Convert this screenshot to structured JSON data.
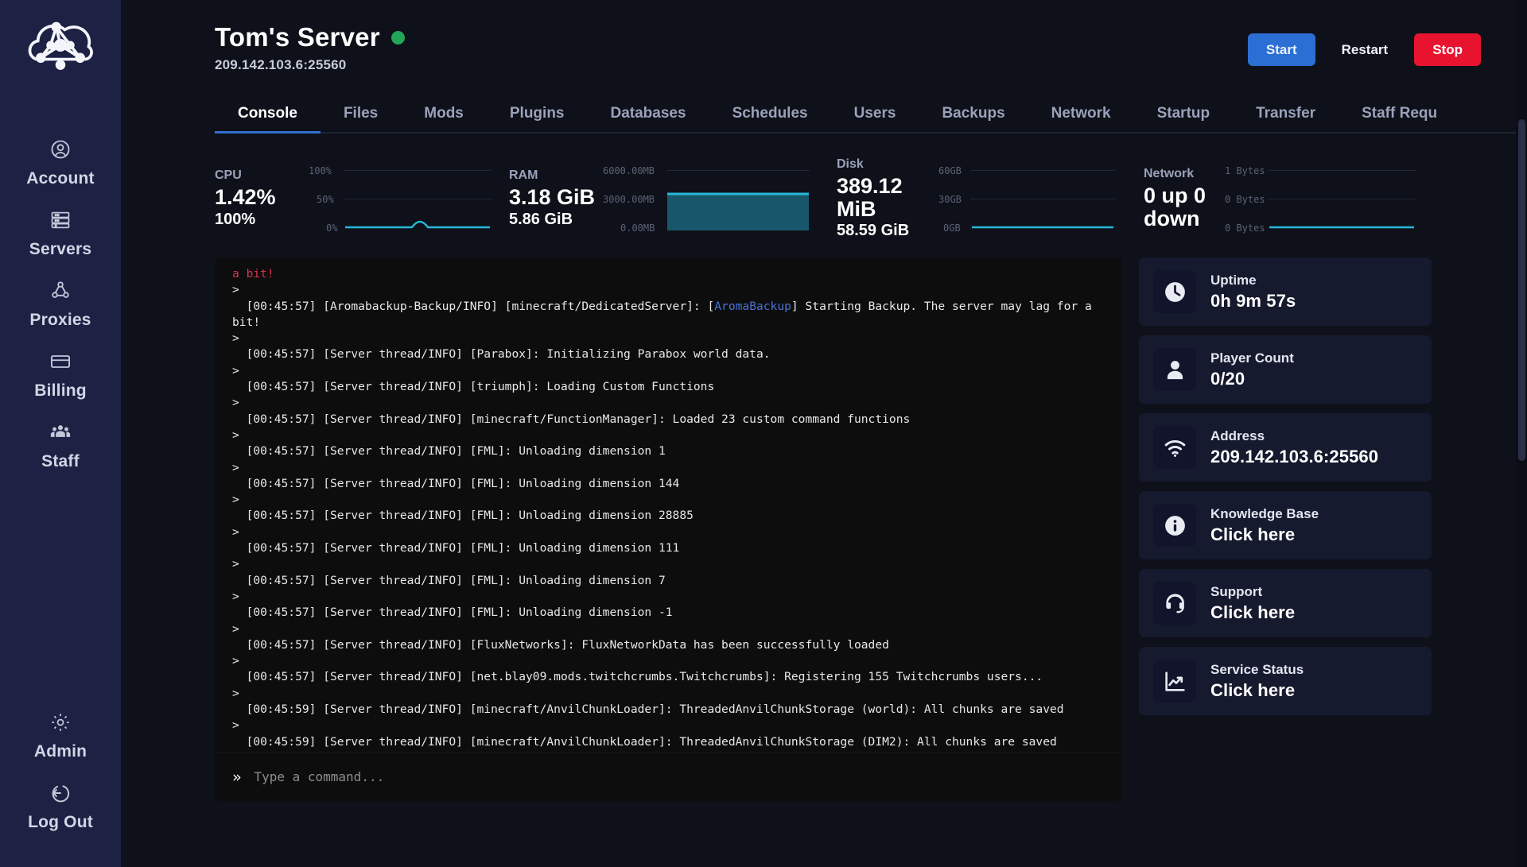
{
  "sidebar": {
    "logo_name": "cloud-network-logo",
    "items": [
      {
        "id": "account",
        "label": "Account",
        "icon": "user-circle-icon"
      },
      {
        "id": "servers",
        "label": "Servers",
        "icon": "server-rack-icon"
      },
      {
        "id": "proxies",
        "label": "Proxies",
        "icon": "proxy-nodes-icon"
      },
      {
        "id": "billing",
        "label": "Billing",
        "icon": "credit-card-icon"
      },
      {
        "id": "staff",
        "label": "Staff",
        "icon": "people-group-icon"
      }
    ],
    "bottom_items": [
      {
        "id": "admin",
        "label": "Admin",
        "icon": "gear-icon"
      },
      {
        "id": "logout",
        "label": "Log Out",
        "icon": "logout-icon"
      }
    ]
  },
  "header": {
    "title": "Tom's Server",
    "status": "online",
    "status_color": "#23a55a",
    "address": "209.142.103.6:25560",
    "buttons": {
      "start": "Start",
      "restart": "Restart",
      "stop": "Stop"
    },
    "colors": {
      "start": "#2b6fd4",
      "stop": "#e8132e",
      "accent": "#2f6fd0"
    }
  },
  "tabs": {
    "active": "Console",
    "items": [
      "Console",
      "Files",
      "Mods",
      "Plugins",
      "Databases",
      "Schedules",
      "Users",
      "Backups",
      "Network",
      "Startup",
      "Transfer",
      "Staff Requ"
    ]
  },
  "stats": [
    {
      "id": "cpu",
      "label": "CPU",
      "value": "1.42%",
      "sub": "100%",
      "axis": [
        "100%",
        "50%",
        "0%"
      ]
    },
    {
      "id": "ram",
      "label": "RAM",
      "value": "3.18 GiB",
      "sub": "5.86 GiB",
      "axis": [
        "6000.00MB",
        "3000.00MB",
        "0.00MB"
      ]
    },
    {
      "id": "disk",
      "label": "Disk",
      "value": "389.12 MiB",
      "sub": "58.59 GiB",
      "axis": [
        "60GB",
        "30GB",
        "0GB"
      ]
    },
    {
      "id": "network",
      "label": "Network",
      "value": "0 up 0 down",
      "sub": "",
      "axis": [
        "1 Bytes",
        "0 Bytes",
        "0 Bytes"
      ]
    }
  ],
  "chart_data": [
    {
      "type": "line",
      "id": "cpu-chart",
      "title": "CPU",
      "ylabel": "",
      "ytick_labels": [
        "100%",
        "50%",
        "0%"
      ],
      "ylim": [
        0,
        100
      ],
      "values": [
        0.8,
        0.9,
        0.8,
        1.0,
        0.9,
        0.8,
        1.0,
        1.1,
        0.9,
        1.0,
        0.9,
        1.0,
        1.2,
        6.0,
        1.3,
        1.0,
        0.9,
        1.0,
        1.1,
        1.42
      ],
      "line_color": "#27b7d8",
      "grid": true,
      "legend": "none"
    },
    {
      "type": "area",
      "id": "ram-chart",
      "title": "RAM",
      "ytick_labels": [
        "6000.00MB",
        "3000.00MB",
        "0.00MB"
      ],
      "ylim": [
        0,
        6000
      ],
      "values": [
        3250,
        3250,
        3250,
        3250,
        3250,
        3250,
        3250,
        3250,
        3250,
        3250
      ],
      "line_color": "#27b7d8",
      "fill_color": "#18576b",
      "grid": true,
      "legend": "none"
    },
    {
      "type": "line",
      "id": "disk-chart",
      "title": "Disk",
      "ytick_labels": [
        "60GB",
        "30GB",
        "0GB"
      ],
      "ylim": [
        0,
        60
      ],
      "values": [
        0.38,
        0.38,
        0.38,
        0.38,
        0.38,
        0.38,
        0.38,
        0.38,
        0.38,
        0.38
      ],
      "line_color": "#27b7d8",
      "grid": true,
      "legend": "none"
    },
    {
      "type": "line",
      "id": "network-chart",
      "title": "Network",
      "ytick_labels": [
        "1 Bytes",
        "0 Bytes",
        "0 Bytes"
      ],
      "ylim": [
        0,
        1
      ],
      "values": [
        0,
        0,
        0,
        0,
        0,
        0,
        0,
        0,
        0,
        0
      ],
      "line_color": "#27b7d8",
      "grid": true,
      "legend": "none"
    }
  ],
  "console": {
    "lines": [
      {
        "type": "text",
        "color": "red",
        "text": "a bit!"
      },
      {
        "type": "prompt",
        "text": ">"
      },
      {
        "type": "text",
        "text": "  [00:45:57] [Aromabackup-Backup/INFO] [minecraft/DedicatedServer]: [",
        "highlight": "AromaBackup",
        "after": "] Starting Backup. The server may lag for a bit!"
      },
      {
        "type": "prompt",
        "text": ">"
      },
      {
        "type": "text",
        "text": "  [00:45:57] [Server thread/INFO] [Parabox]: Initializing Parabox world data."
      },
      {
        "type": "prompt",
        "text": ">"
      },
      {
        "type": "text",
        "text": "  [00:45:57] [Server thread/INFO] [triumph]: Loading Custom Functions"
      },
      {
        "type": "prompt",
        "text": ">"
      },
      {
        "type": "text",
        "text": "  [00:45:57] [Server thread/INFO] [minecraft/FunctionManager]: Loaded 23 custom command functions"
      },
      {
        "type": "prompt",
        "text": ">"
      },
      {
        "type": "text",
        "text": "  [00:45:57] [Server thread/INFO] [FML]: Unloading dimension 1"
      },
      {
        "type": "prompt",
        "text": ">"
      },
      {
        "type": "text",
        "text": "  [00:45:57] [Server thread/INFO] [FML]: Unloading dimension 144"
      },
      {
        "type": "prompt",
        "text": ">"
      },
      {
        "type": "text",
        "text": "  [00:45:57] [Server thread/INFO] [FML]: Unloading dimension 28885"
      },
      {
        "type": "prompt",
        "text": ">"
      },
      {
        "type": "text",
        "text": "  [00:45:57] [Server thread/INFO] [FML]: Unloading dimension 111"
      },
      {
        "type": "prompt",
        "text": ">"
      },
      {
        "type": "text",
        "text": "  [00:45:57] [Server thread/INFO] [FML]: Unloading dimension 7"
      },
      {
        "type": "prompt",
        "text": ">"
      },
      {
        "type": "text",
        "text": "  [00:45:57] [Server thread/INFO] [FML]: Unloading dimension -1"
      },
      {
        "type": "prompt",
        "text": ">"
      },
      {
        "type": "text",
        "text": "  [00:45:57] [Server thread/INFO] [FluxNetworks]: FluxNetworkData has been successfully loaded"
      },
      {
        "type": "prompt",
        "text": ">"
      },
      {
        "type": "text",
        "text": "  [00:45:57] [Server thread/INFO] [net.blay09.mods.twitchcrumbs.Twitchcrumbs]: Registering 155 Twitchcrumbs users..."
      },
      {
        "type": "prompt",
        "text": ">"
      },
      {
        "type": "text",
        "text": "  [00:45:59] [Server thread/INFO] [minecraft/AnvilChunkLoader]: ThreadedAnvilChunkStorage (world): All chunks are saved"
      },
      {
        "type": "prompt",
        "text": ">"
      },
      {
        "type": "text",
        "text": "  [00:45:59] [Server thread/INFO] [minecraft/AnvilChunkLoader]: ThreadedAnvilChunkStorage (DIM2): All chunks are saved"
      }
    ],
    "input_prefix": "»",
    "input_placeholder": "Type a command...",
    "input_value": ""
  },
  "infocards": [
    {
      "id": "uptime",
      "icon": "clock-icon",
      "label": "Uptime",
      "value": "0h 9m 57s"
    },
    {
      "id": "player-count",
      "icon": "user-icon",
      "label": "Player Count",
      "value": "0/20"
    },
    {
      "id": "address",
      "icon": "wifi-icon",
      "label": "Address",
      "value": "209.142.103.6:25560"
    },
    {
      "id": "knowledge-base",
      "icon": "info-icon",
      "label": "Knowledge Base",
      "value": "Click here"
    },
    {
      "id": "support",
      "icon": "headset-icon",
      "label": "Support",
      "value": "Click here"
    },
    {
      "id": "service-status",
      "icon": "chart-trend-icon",
      "label": "Service Status",
      "value": "Click here"
    }
  ]
}
